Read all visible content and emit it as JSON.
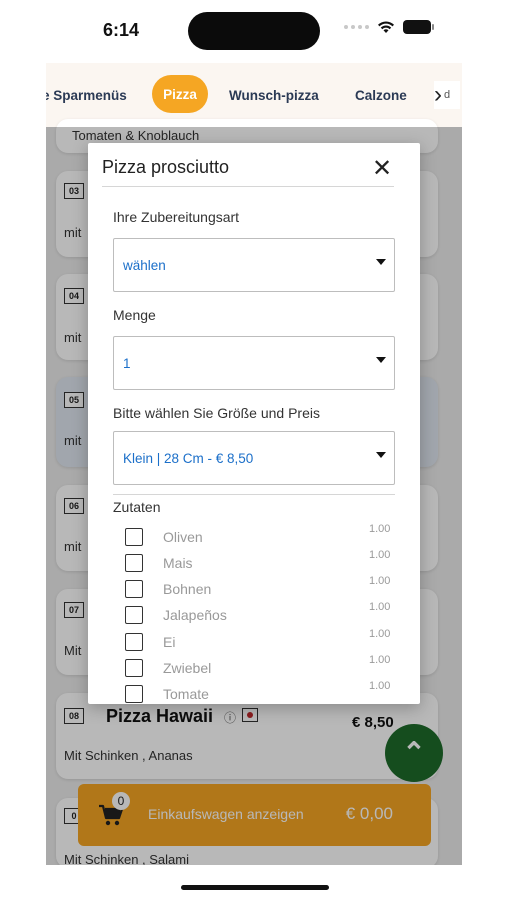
{
  "status_bar": {
    "time": "6:14"
  },
  "categories": {
    "items": [
      {
        "label": "e Sparmenüs"
      },
      {
        "label": "Pizza",
        "active": true
      },
      {
        "label": "Wunsch-pizza"
      },
      {
        "label": "Calzone"
      }
    ],
    "next_overflow": "d"
  },
  "menu": {
    "top_snippet": "Tomaten & Knoblauch",
    "items": [
      {
        "number": "03",
        "desc": "mit"
      },
      {
        "number": "04",
        "desc": "mit"
      },
      {
        "number": "05",
        "desc": "mit"
      },
      {
        "number": "06",
        "desc": "mit"
      },
      {
        "number": "07",
        "desc": "Mit"
      },
      {
        "number": "08",
        "title": "Pizza Hawaii",
        "desc": "Mit Schinken , Ananas",
        "price": "€ 8,50"
      },
      {
        "number": "0",
        "desc": "Mit Schinken , Salami"
      }
    ]
  },
  "cart": {
    "count": "0",
    "label": "Einkaufswagen anzeigen",
    "total": "€ 0,00"
  },
  "modal": {
    "title": "Pizza prosciutto",
    "close": "✕",
    "prep_label": "Ihre Zubereitungsart",
    "prep_value": "wählen",
    "qty_label": "Menge",
    "qty_value": "1",
    "size_label": "Bitte wählen Sie Größe und Preis",
    "size_value": "Klein | 28 Cm - € 8,50",
    "ingredients_label": "Zutaten",
    "ingredients": [
      {
        "name": "Oliven",
        "price": "1.00"
      },
      {
        "name": "Mais",
        "price": "1.00"
      },
      {
        "name": "Bohnen",
        "price": "1.00"
      },
      {
        "name": "Jalapeños",
        "price": "1.00"
      },
      {
        "name": "Ei",
        "price": "1.00"
      },
      {
        "name": "Zwiebel",
        "price": "1.00"
      },
      {
        "name": "Tomate",
        "price": "1.00"
      }
    ]
  }
}
